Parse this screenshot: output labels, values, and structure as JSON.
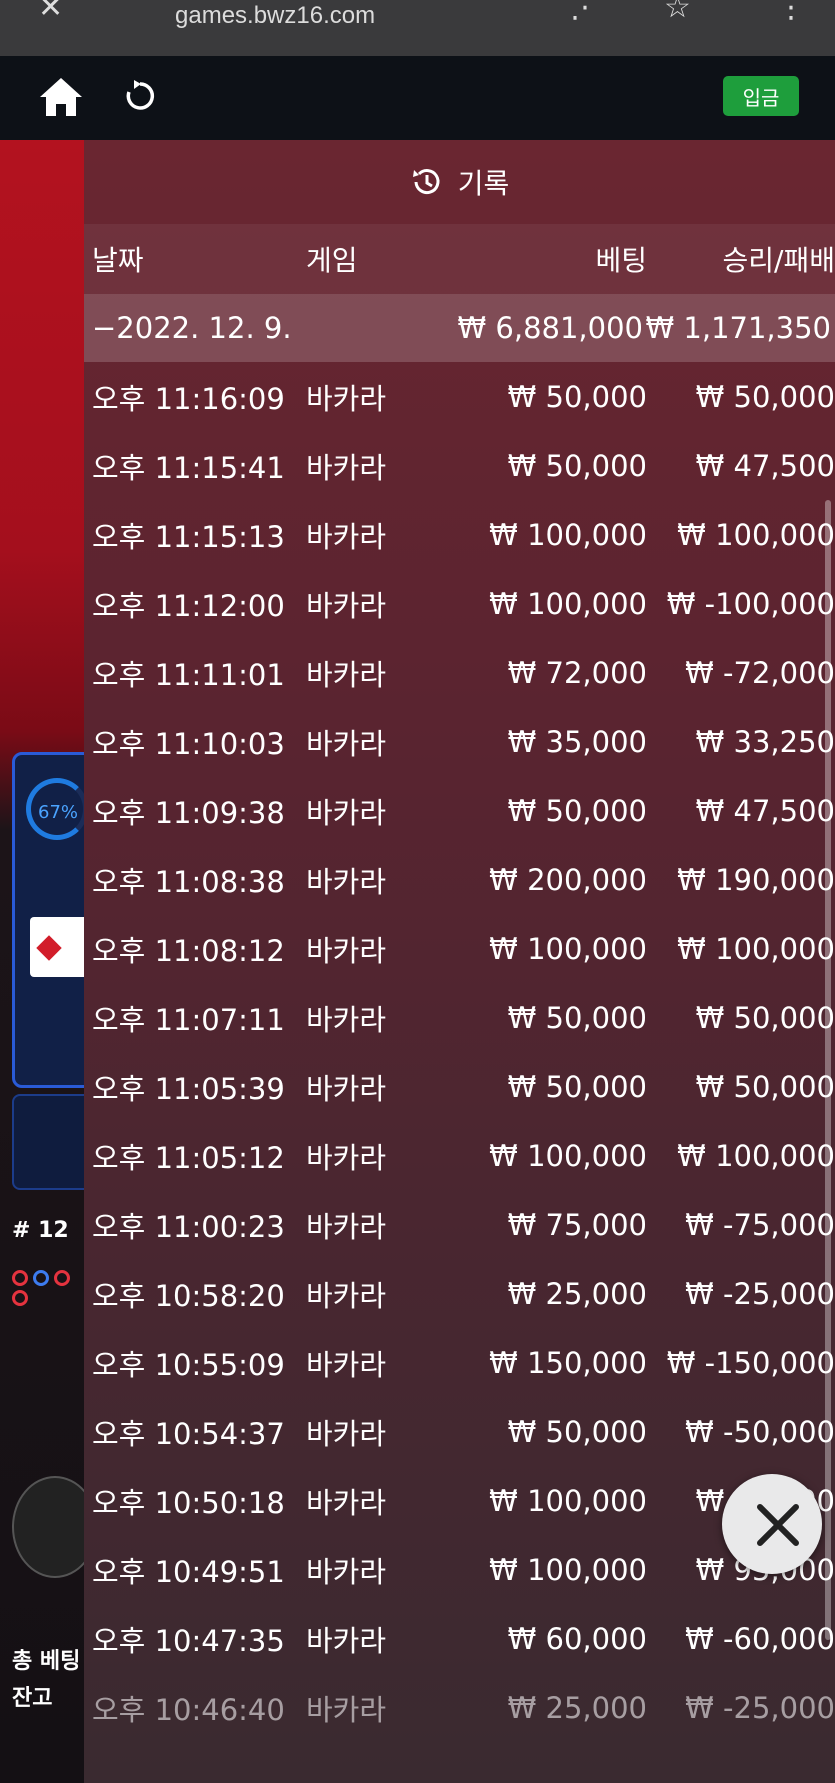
{
  "browser": {
    "url": "games.bwz16.com"
  },
  "header": {
    "deposit_label": "입금"
  },
  "background": {
    "percent": "67%",
    "round": "# 12",
    "total_bet_label": "총 베팅",
    "balance_label": "잔고"
  },
  "history": {
    "title": "기록",
    "columns": {
      "date": "날짜",
      "game": "게임",
      "bet": "베팅",
      "win_loss": "승리/패배"
    },
    "summary": {
      "date": "−2022. 12. 9.",
      "bet": "₩ 6,881,000",
      "win_loss": "₩ 1,171,350"
    },
    "rows": [
      {
        "time": "오후 11:16:09",
        "game": "바카라",
        "bet": "₩ 50,000",
        "win_loss": "₩ 50,000"
      },
      {
        "time": "오후 11:15:41",
        "game": "바카라",
        "bet": "₩ 50,000",
        "win_loss": "₩ 47,500"
      },
      {
        "time": "오후 11:15:13",
        "game": "바카라",
        "bet": "₩ 100,000",
        "win_loss": "₩ 100,000"
      },
      {
        "time": "오후 11:12:00",
        "game": "바카라",
        "bet": "₩ 100,000",
        "win_loss": "₩ -100,000"
      },
      {
        "time": "오후 11:11:01",
        "game": "바카라",
        "bet": "₩ 72,000",
        "win_loss": "₩ -72,000"
      },
      {
        "time": "오후 11:10:03",
        "game": "바카라",
        "bet": "₩ 35,000",
        "win_loss": "₩ 33,250"
      },
      {
        "time": "오후 11:09:38",
        "game": "바카라",
        "bet": "₩ 50,000",
        "win_loss": "₩ 47,500"
      },
      {
        "time": "오후 11:08:38",
        "game": "바카라",
        "bet": "₩ 200,000",
        "win_loss": "₩ 190,000"
      },
      {
        "time": "오후 11:08:12",
        "game": "바카라",
        "bet": "₩ 100,000",
        "win_loss": "₩ 100,000"
      },
      {
        "time": "오후 11:07:11",
        "game": "바카라",
        "bet": "₩ 50,000",
        "win_loss": "₩ 50,000"
      },
      {
        "time": "오후 11:05:39",
        "game": "바카라",
        "bet": "₩ 50,000",
        "win_loss": "₩ 50,000"
      },
      {
        "time": "오후 11:05:12",
        "game": "바카라",
        "bet": "₩ 100,000",
        "win_loss": "₩ 100,000"
      },
      {
        "time": "오후 11:00:23",
        "game": "바카라",
        "bet": "₩ 75,000",
        "win_loss": "₩ -75,000"
      },
      {
        "time": "오후 10:58:20",
        "game": "바카라",
        "bet": "₩ 25,000",
        "win_loss": "₩ -25,000"
      },
      {
        "time": "오후 10:55:09",
        "game": "바카라",
        "bet": "₩ 150,000",
        "win_loss": "₩ -150,000"
      },
      {
        "time": "오후 10:54:37",
        "game": "바카라",
        "bet": "₩ 50,000",
        "win_loss": "₩ -50,000"
      },
      {
        "time": "오후 10:50:18",
        "game": "바카라",
        "bet": "₩ 100,000",
        "win_loss": "₩ 95,000"
      },
      {
        "time": "오후 10:49:51",
        "game": "바카라",
        "bet": "₩ 100,000",
        "win_loss": "₩ 95,000"
      },
      {
        "time": "오후 10:47:35",
        "game": "바카라",
        "bet": "₩ 60,000",
        "win_loss": "₩ -60,000"
      },
      {
        "time": "오후 10:46:40",
        "game": "바카라",
        "bet": "₩ 25,000",
        "win_loss": "₩ -25,000"
      }
    ]
  },
  "icons": {
    "home": "home-icon",
    "refresh": "refresh-icon",
    "history": "clock-history-icon",
    "close": "close-icon"
  },
  "colors": {
    "deposit": "#1e9e3c",
    "header_bg": "#0d1117",
    "panel_bg": "#5a2430"
  }
}
